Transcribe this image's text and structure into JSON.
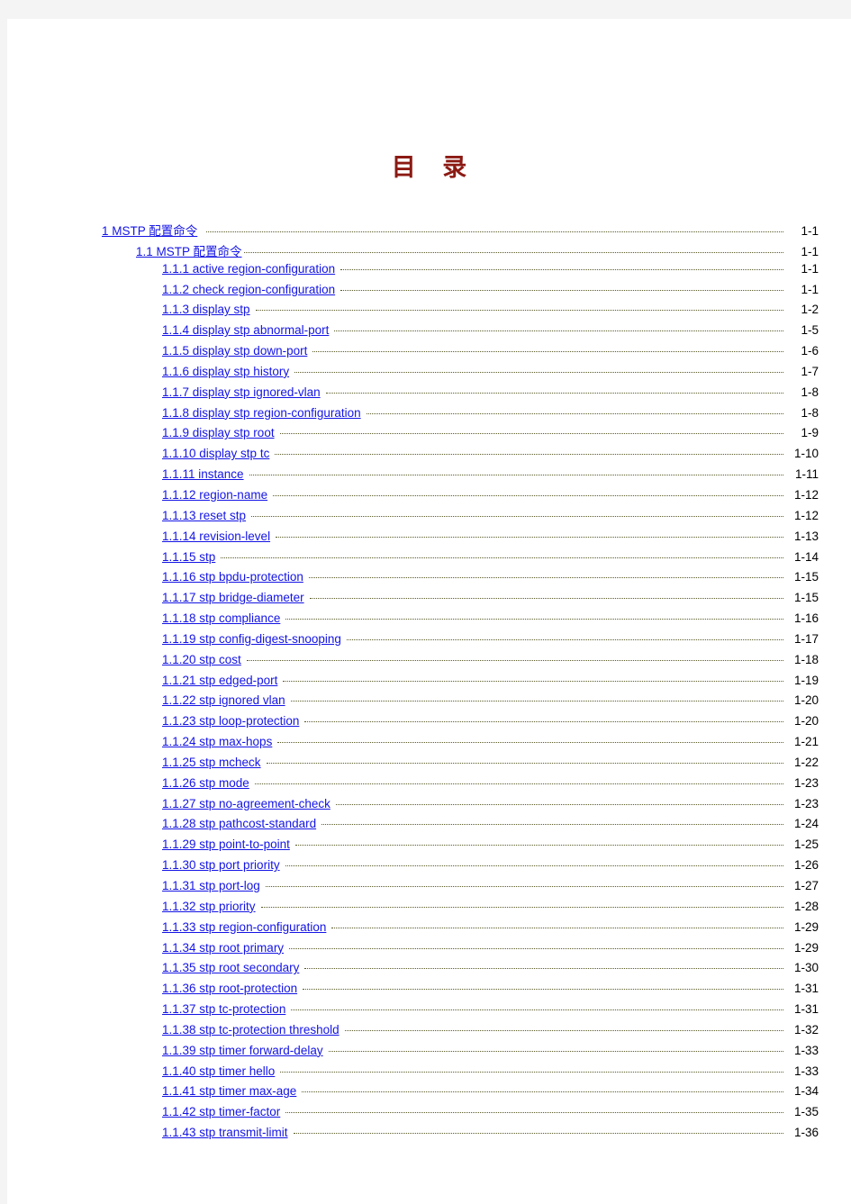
{
  "document": {
    "title": "目  录"
  },
  "toc": {
    "entries": [
      {
        "level": 1,
        "label": "1 MSTP 配置命令",
        "page": "1-1"
      },
      {
        "level": 2,
        "label": "1.1 MSTP 配置命令",
        "page": "1-1"
      },
      {
        "level": 3,
        "label": "1.1.1  active region-configuration",
        "page": "1-1"
      },
      {
        "level": 3,
        "label": "1.1.2  check region-configuration",
        "page": "1-1"
      },
      {
        "level": 3,
        "label": "1.1.3  display stp",
        "page": "1-2"
      },
      {
        "level": 3,
        "label": "1.1.4  display stp abnormal-port",
        "page": "1-5"
      },
      {
        "level": 3,
        "label": "1.1.5  display stp down-port",
        "page": "1-6"
      },
      {
        "level": 3,
        "label": "1.1.6  display stp history",
        "page": "1-7"
      },
      {
        "level": 3,
        "label": "1.1.7  display stp ignored-vlan",
        "page": "1-8"
      },
      {
        "level": 3,
        "label": "1.1.8  display stp region-configuration",
        "page": "1-8"
      },
      {
        "level": 3,
        "label": "1.1.9  display stp root",
        "page": "1-9"
      },
      {
        "level": 3,
        "label": "1.1.10  display stp tc",
        "page": "1-10"
      },
      {
        "level": 3,
        "label": "1.1.11  instance",
        "page": "1-11"
      },
      {
        "level": 3,
        "label": "1.1.12  region-name",
        "page": "1-12"
      },
      {
        "level": 3,
        "label": "1.1.13  reset stp",
        "page": "1-12"
      },
      {
        "level": 3,
        "label": "1.1.14  revision-level",
        "page": "1-13"
      },
      {
        "level": 3,
        "label": "1.1.15  stp",
        "page": "1-14"
      },
      {
        "level": 3,
        "label": "1.1.16  stp bpdu-protection",
        "page": "1-15"
      },
      {
        "level": 3,
        "label": "1.1.17  stp bridge-diameter",
        "page": "1-15"
      },
      {
        "level": 3,
        "label": "1.1.18  stp compliance",
        "page": "1-16"
      },
      {
        "level": 3,
        "label": "1.1.19  stp config-digest-snooping",
        "page": "1-17"
      },
      {
        "level": 3,
        "label": "1.1.20  stp cost",
        "page": "1-18"
      },
      {
        "level": 3,
        "label": "1.1.21  stp edged-port",
        "page": "1-19"
      },
      {
        "level": 3,
        "label": "1.1.22  stp ignored vlan",
        "page": "1-20"
      },
      {
        "level": 3,
        "label": "1.1.23  stp loop-protection",
        "page": "1-20"
      },
      {
        "level": 3,
        "label": "1.1.24  stp max-hops",
        "page": "1-21"
      },
      {
        "level": 3,
        "label": "1.1.25  stp mcheck",
        "page": "1-22"
      },
      {
        "level": 3,
        "label": "1.1.26  stp mode",
        "page": "1-23"
      },
      {
        "level": 3,
        "label": "1.1.27  stp no-agreement-check",
        "page": "1-23"
      },
      {
        "level": 3,
        "label": "1.1.28  stp pathcost-standard",
        "page": "1-24"
      },
      {
        "level": 3,
        "label": "1.1.29  stp point-to-point",
        "page": "1-25"
      },
      {
        "level": 3,
        "label": "1.1.30  stp port priority",
        "page": "1-26"
      },
      {
        "level": 3,
        "label": "1.1.31  stp port-log",
        "page": "1-27"
      },
      {
        "level": 3,
        "label": "1.1.32  stp priority",
        "page": "1-28"
      },
      {
        "level": 3,
        "label": "1.1.33  stp region-configuration",
        "page": "1-29"
      },
      {
        "level": 3,
        "label": "1.1.34  stp root primary",
        "page": "1-29"
      },
      {
        "level": 3,
        "label": "1.1.35  stp root secondary",
        "page": "1-30"
      },
      {
        "level": 3,
        "label": "1.1.36  stp root-protection",
        "page": "1-31"
      },
      {
        "level": 3,
        "label": "1.1.37  stp tc-protection",
        "page": "1-31"
      },
      {
        "level": 3,
        "label": "1.1.38  stp tc-protection threshold",
        "page": "1-32"
      },
      {
        "level": 3,
        "label": "1.1.39  stp timer forward-delay",
        "page": "1-33"
      },
      {
        "level": 3,
        "label": "1.1.40  stp timer hello",
        "page": "1-33"
      },
      {
        "level": 3,
        "label": "1.1.41  stp timer max-age",
        "page": "1-34"
      },
      {
        "level": 3,
        "label": "1.1.42  stp timer-factor",
        "page": "1-35"
      },
      {
        "level": 3,
        "label": "1.1.43  stp transmit-limit",
        "page": "1-36"
      }
    ]
  }
}
